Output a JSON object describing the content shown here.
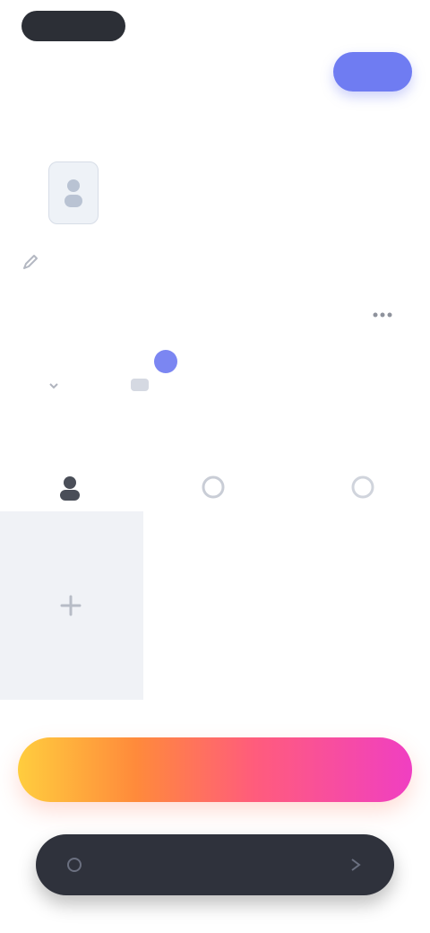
{
  "header": {
    "user_name": "",
    "subtitle": "",
    "top_right_label": "",
    "small_status": "",
    "action_button_label": ""
  },
  "profile": {
    "label": "",
    "stats": [
      {
        "value": "",
        "label": ""
      },
      {
        "value": "",
        "label": ""
      },
      {
        "value": "",
        "label": ""
      }
    ]
  },
  "tabs": {
    "items": [
      {
        "label": ""
      },
      {
        "label": ""
      }
    ]
  },
  "notifications": {
    "count": ""
  },
  "caption": "",
  "cta": {
    "label": ""
  },
  "bottom_bar": {
    "label": ""
  },
  "colors": {
    "accent": "#6f7cf2",
    "dark": "#2c2f36",
    "gradient_start": "#ffcd3e",
    "gradient_end": "#f03fc2"
  },
  "icons": {
    "avatar": "person-icon",
    "edit": "pencil-icon",
    "more": "more-icon",
    "row": [
      "user-icon",
      "circle-icon",
      "circle-icon"
    ],
    "add": "plus-icon"
  }
}
